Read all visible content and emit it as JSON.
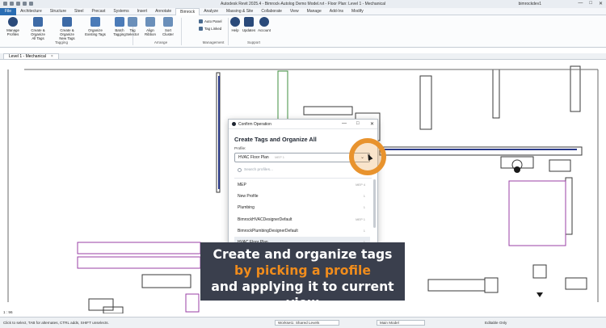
{
  "window": {
    "title": "Autodesk Revit 2025.4 - Bimrock-Autolog Demo Model.rvt - Floor Plan: Level 1 - Mechanical",
    "user": "bimrockdev1",
    "controls": [
      "—",
      "□",
      "✕"
    ]
  },
  "ribbon_tabs": [
    "File",
    "Architecture",
    "Structure",
    "Steel",
    "Precast",
    "Systems",
    "Insert",
    "Annotate",
    "Bimrock",
    "Analyze",
    "Massing & Site",
    "Collaborate",
    "View",
    "Manage",
    "Add-Ins",
    "Modify"
  ],
  "active_tab": "Bimrock",
  "ribbon": {
    "buttons": [
      {
        "label": "Manage\nProfiles",
        "color": "#2a4a7a"
      },
      {
        "label": "Create & Organize\nAll Tags",
        "color": "#3d6aa6"
      },
      {
        "label": "Create & Organize\nNew Tags",
        "color": "#3d6aa6"
      },
      {
        "label": "Organize\nExisting Tags",
        "color": "#4b7bb8"
      },
      {
        "label": "Batch\nTagging",
        "color": "#4b7bb8"
      },
      {
        "label": "Tag\nSelector",
        "color": "#6a8fba"
      },
      {
        "label": "Align\nRibbon",
        "color": "#6a8fba"
      },
      {
        "label": "Sort\nCluster",
        "color": "#6a8fba"
      },
      {
        "label": "Help",
        "color": "#2a4a7a"
      },
      {
        "label": "Updates",
        "color": "#2a4a7a"
      },
      {
        "label": "Account",
        "color": "#2a4a7a"
      }
    ],
    "small_buttons": [
      "Auto Panel",
      "Tag Linked"
    ],
    "groups": {
      "tagging": "Tagging",
      "arrange": "Arrange",
      "management": "Management",
      "support": "Support"
    }
  },
  "view_tab": {
    "label": "Level 1 - Mechanical",
    "close": "×"
  },
  "dialog": {
    "title": "Confirm Operation",
    "heading": "Create Tags and Organize All",
    "profile_label": "Profile:",
    "selected_profile": "HVAC Floor Plan",
    "selected_count": "MEP 1",
    "search_placeholder": "Search profiles...",
    "profiles": [
      {
        "name": "MEP",
        "count": "MEP 4"
      },
      {
        "name": "New Profile",
        "count": "1"
      },
      {
        "name": "Plumbing",
        "count": "1"
      },
      {
        "name": "BimrockHVACDesignerDefault",
        "count": "MEP 1"
      },
      {
        "name": "BimrockPlumbingDesignerDefault",
        "count": "1"
      },
      {
        "name": "HVAC Floor Plan",
        "count": "1"
      }
    ],
    "selected_index": 5
  },
  "caption": {
    "line1": "Create and organize tags",
    "line2": "by picking a profile",
    "line3": "and applying it to current view"
  },
  "status_bar": {
    "hint": "Click to select, TAB for alternates, CTRL adds, SHIFT unselects.",
    "workset": "Workset1: Shared Levels",
    "main_model": "Main Model",
    "editable_only": "Editable Only",
    "scale": "1 : 96"
  },
  "colors": {
    "accent": "#f08c1c",
    "caption_bg": "#3a3f4d",
    "file_tab": "#2a6db3"
  }
}
